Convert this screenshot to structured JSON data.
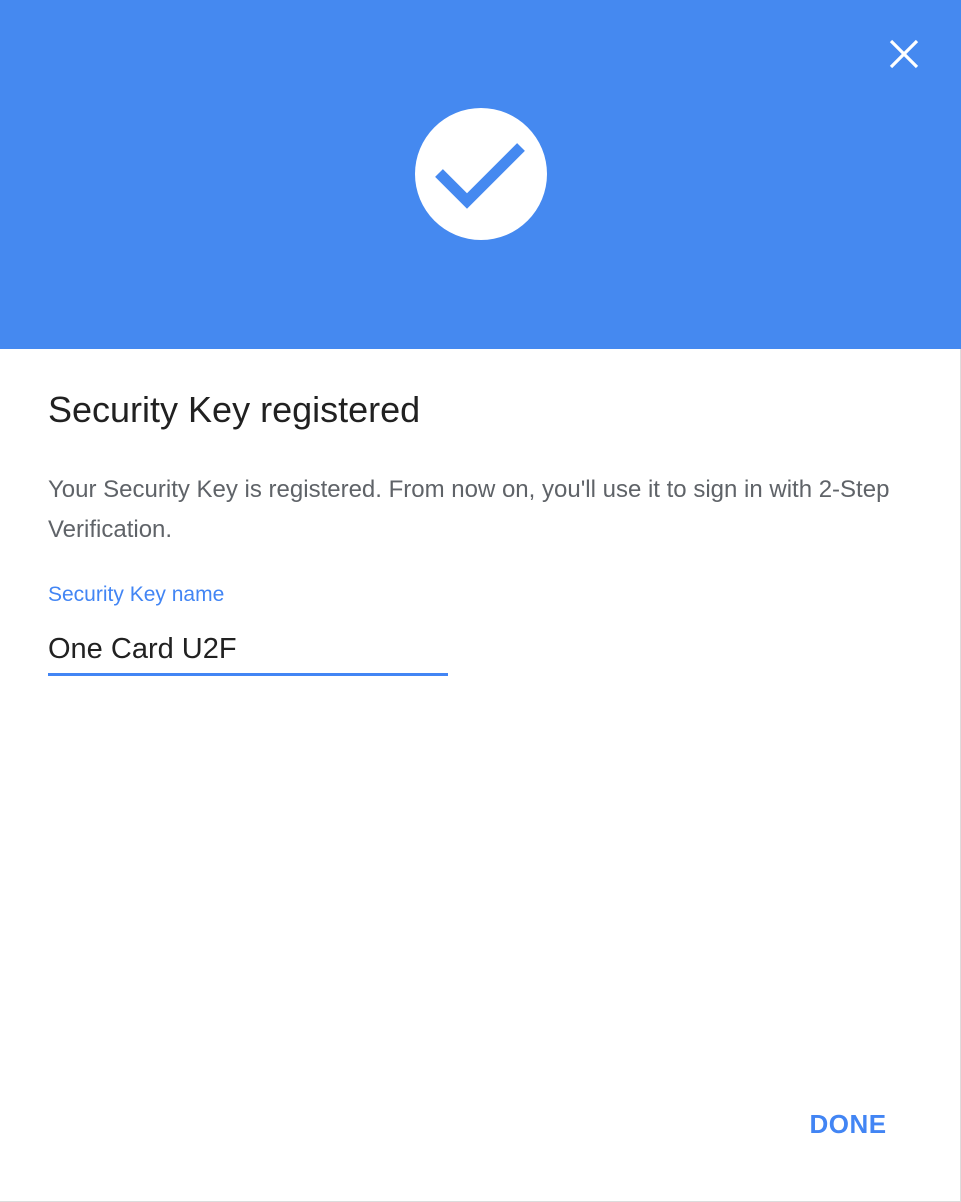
{
  "header": {
    "background_color": "#4589f0",
    "close_icon": "close-icon",
    "status_icon": "check-icon"
  },
  "content": {
    "title": "Security Key registered",
    "description": "Your Security Key is registered. From now on, you'll use it to sign in with 2-Step Verification.",
    "name_field": {
      "label": "Security Key name",
      "value": "One Card U2F",
      "accent_color": "#4285f4"
    }
  },
  "actions": {
    "done_label": "DONE"
  }
}
